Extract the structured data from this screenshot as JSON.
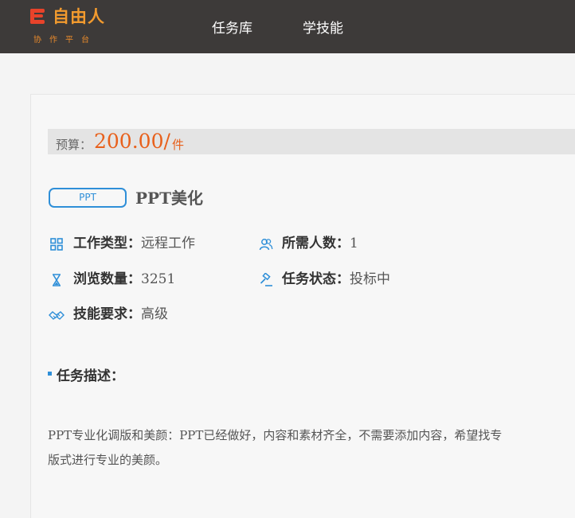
{
  "header": {
    "logo_title": "自由人",
    "logo_subtitle": "协作平台",
    "nav": [
      "任务库",
      "学技能"
    ]
  },
  "budget": {
    "label": "预算：",
    "amount": "200.00/",
    "unit": "件"
  },
  "task": {
    "tag": "PPT",
    "title": "PPT美化"
  },
  "info": {
    "work_type": {
      "label": "工作类型：",
      "value": "远程工作",
      "icon": "grid-icon"
    },
    "people_needed": {
      "label": "所需人数：",
      "value": "1",
      "icon": "users-icon"
    },
    "views": {
      "label": "浏览数量：",
      "value": "3251",
      "icon": "hourglass-icon"
    },
    "status": {
      "label": "任务状态：",
      "value": "投标中",
      "icon": "gavel-icon"
    },
    "skill": {
      "label": "技能要求：",
      "value": "高级",
      "icon": "handshake-icon"
    }
  },
  "description": {
    "heading": "任务描述：",
    "line1": "PPT专业化调版和美颜：PPT已经做好，内容和素材齐全，不需要添加内容，希望找专",
    "line2": "版式进行专业的美颜。"
  },
  "colors": {
    "header_bg": "#3d3a39",
    "accent_orange": "#e8601b",
    "accent_blue": "#2f8fd8"
  }
}
